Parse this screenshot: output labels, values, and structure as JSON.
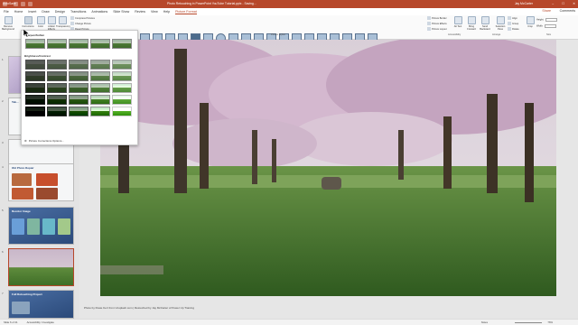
{
  "titlebar": {
    "autosave": "AutoSave",
    "title": "Photo Retouching in PowerPoint YouTube Tutorial.pptx - Saving...",
    "user": "Jay McCarter"
  },
  "tabs": [
    "File",
    "Home",
    "Insert",
    "Draw",
    "Design",
    "Transitions",
    "Animations",
    "Slide Show",
    "Review",
    "View",
    "Help",
    "Picture Format"
  ],
  "active_tab": "Picture Format",
  "share": "Share",
  "comments": "Comments",
  "ribbon": {
    "remove_bg": "Remove Background",
    "corrections": "Corrections",
    "color": "Color",
    "artistic": "Artistic Effects",
    "transparency": "Transparency",
    "compress": "Compress Pictures",
    "change": "Change Picture",
    "reset": "Reset Picture",
    "styles_label": "Picture Styles",
    "border": "Picture Border",
    "effects": "Picture Effects",
    "layout": "Picture Layout",
    "alt_text": "Alt Text",
    "bring_forward": "Bring Forward",
    "send_backward": "Send Backward",
    "selection_pane": "Selection Pane",
    "align": "Align",
    "group": "Group",
    "rotate": "Rotate",
    "crop": "Crop",
    "accessibility": "Accessibility",
    "arrange": "Arrange",
    "size": "Size",
    "height_label": "Height:",
    "width_label": "Width:"
  },
  "dropdown": {
    "sharpen_label": "Sharpen/Soften",
    "brightness_label": "Brightness/Contrast",
    "options_label": "Picture Corrections Options..."
  },
  "slides": [
    {
      "num": "1"
    },
    {
      "num": "2",
      "title": "Tab..."
    },
    {
      "num": "3"
    },
    {
      "num": "4",
      "title": "Old Photo Repair"
    },
    {
      "num": "5",
      "title": "Recolor Image"
    },
    {
      "num": "6"
    },
    {
      "num": "7",
      "title": "Full Retouching Project"
    }
  ],
  "caption": "Photo by Rosie Kerr from Unsplash.com | Retouched by Jay McCarter of Power Up Training",
  "status": {
    "slide": "Slide 6 of 21",
    "accessibility": "Accessibility: Investigate",
    "notes": "Notes",
    "zoom": "76%"
  }
}
